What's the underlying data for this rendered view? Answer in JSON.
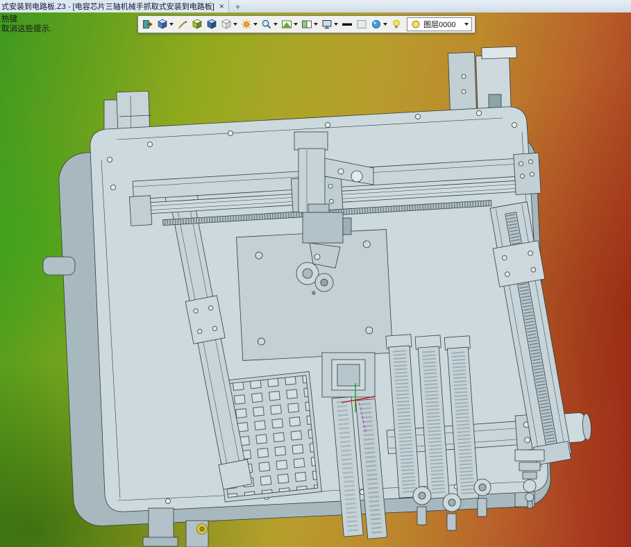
{
  "window": {
    "tab_title": "式安装到电路板.Z3 - [电容芯片三轴机械手抓取式安装到电路板]",
    "close_glyph": "×",
    "new_tab_glyph": "+"
  },
  "viewport": {
    "hint_line1": "热键",
    "hint_line2": "取消这些提示.",
    "background_colors": [
      "#3f9a20",
      "#8ea91e",
      "#b79e2d",
      "#b9642a",
      "#9c2d1b"
    ]
  },
  "toolbar": {
    "icons": [
      {
        "name": "exit-icon",
        "shape": "exit",
        "dropdown": false
      },
      {
        "name": "shade-mode-icon",
        "shape": "cube-blue",
        "dropdown": true
      },
      {
        "name": "edge-display-icon",
        "shape": "pen",
        "dropdown": false
      },
      {
        "name": "face-display-icon",
        "shape": "cube-green",
        "dropdown": false
      },
      {
        "name": "solid-display-icon",
        "shape": "cube-deepblue",
        "dropdown": false
      },
      {
        "name": "wireframe-display-icon",
        "shape": "cube-white",
        "dropdown": true
      },
      {
        "name": "render-settings-icon",
        "shape": "sun",
        "dropdown": true
      },
      {
        "name": "zoom-icon",
        "shape": "magnifier",
        "dropdown": true
      },
      {
        "name": "view-orient-icon",
        "shape": "view-green",
        "dropdown": true
      },
      {
        "name": "split-view-icon",
        "shape": "split",
        "dropdown": true
      },
      {
        "name": "display-target-icon",
        "shape": "monitor",
        "dropdown": true
      },
      {
        "name": "line-width-icon",
        "shape": "bar-black",
        "dropdown": false
      },
      {
        "name": "background-swatch-icon",
        "shape": "square-light",
        "dropdown": false
      },
      {
        "name": "material-icon",
        "shape": "material",
        "dropdown": true
      }
    ],
    "bulb_icon": {
      "name": "visibility-bulb-icon",
      "shape": "bulb"
    },
    "layer_combo": {
      "label": "图层0000",
      "shape": "circle-yellow"
    }
  },
  "model": {
    "body_color": "#ccd9dd",
    "outline_color": "#2e3b40",
    "axis_x_color": "#cc0000",
    "axis_y_color": "#00aa00"
  }
}
